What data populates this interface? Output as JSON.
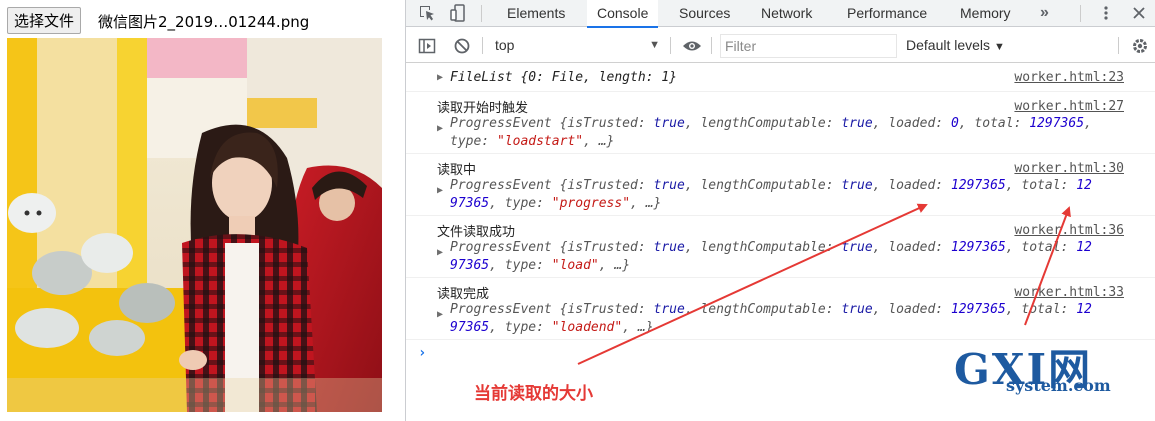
{
  "page": {
    "file_button_label": "选择文件",
    "file_name": "微信图片2_2019…01244.png"
  },
  "devtools": {
    "tabs": [
      "Elements",
      "Console",
      "Sources",
      "Network",
      "Performance",
      "Memory"
    ],
    "active_tab": "Console",
    "context": "top",
    "filter_placeholder": "Filter",
    "levels_label": "Default levels",
    "more_tabs": "»"
  },
  "console": {
    "messages": [
      {
        "label": "",
        "source": "worker.html:23",
        "lines": [
          [
            "FileList {0: File, length: 1}"
          ]
        ]
      },
      {
        "label": "读取开始时触发",
        "source": "worker.html:27",
        "lines": [
          [
            [
              "k",
              "ProgressEvent {isTrusted: "
            ],
            [
              "b",
              "true"
            ],
            [
              "k",
              ", lengthComputable: "
            ],
            [
              "b",
              "true"
            ],
            [
              "k",
              ", loaded: "
            ],
            [
              "n",
              "0"
            ],
            [
              "k",
              ", total: "
            ],
            [
              "n",
              "1297365"
            ],
            [
              "k",
              ","
            ]
          ],
          [
            [
              "k",
              "type: "
            ],
            [
              "s",
              "\"loadstart\""
            ],
            [
              "k",
              ", …}"
            ]
          ]
        ]
      },
      {
        "label": "读取中",
        "source": "worker.html:30",
        "lines": [
          [
            [
              "k",
              "ProgressEvent {isTrusted: "
            ],
            [
              "b",
              "true"
            ],
            [
              "k",
              ", lengthComputable: "
            ],
            [
              "b",
              "true"
            ],
            [
              "k",
              ", loaded: "
            ],
            [
              "n",
              "1297365"
            ],
            [
              "k",
              ", total: "
            ],
            [
              "n",
              "12"
            ]
          ],
          [
            [
              "n",
              "97365"
            ],
            [
              "k",
              ", type: "
            ],
            [
              "s",
              "\"progress\""
            ],
            [
              "k",
              ", …}"
            ]
          ]
        ]
      },
      {
        "label": "文件读取成功",
        "source": "worker.html:36",
        "lines": [
          [
            [
              "k",
              "ProgressEvent {isTrusted: "
            ],
            [
              "b",
              "true"
            ],
            [
              "k",
              ", lengthComputable: "
            ],
            [
              "b",
              "true"
            ],
            [
              "k",
              ", loaded: "
            ],
            [
              "n",
              "1297365"
            ],
            [
              "k",
              ", total: "
            ],
            [
              "n",
              "12"
            ]
          ],
          [
            [
              "n",
              "97365"
            ],
            [
              "k",
              ", type: "
            ],
            [
              "s",
              "\"load\""
            ],
            [
              "k",
              ", …}"
            ]
          ]
        ]
      },
      {
        "label": "读取完成",
        "source": "worker.html:33",
        "lines": [
          [
            [
              "k",
              "ProgressEvent {isTrusted: "
            ],
            [
              "b",
              "true"
            ],
            [
              "k",
              ", lengthComputable: "
            ],
            [
              "b",
              "true"
            ],
            [
              "k",
              ", loaded: "
            ],
            [
              "n",
              "1297365"
            ],
            [
              "k",
              ", total: "
            ],
            [
              "n",
              "12"
            ]
          ],
          [
            [
              "n",
              "97365"
            ],
            [
              "k",
              ", type: "
            ],
            [
              "s",
              "\"loadend\""
            ],
            [
              "k",
              ", …}"
            ]
          ]
        ]
      }
    ],
    "prompt": "›"
  },
  "annotation": {
    "text": "当前读取的大小",
    "color": "#e53935"
  },
  "watermark": {
    "big": "GXI网",
    "small": "system.com"
  },
  "colors": {
    "accent": "#1a73e8",
    "number": "#1c00cf",
    "string": "#c41a16",
    "boolean": "#1a1aa6",
    "arrow": "#e53935"
  }
}
